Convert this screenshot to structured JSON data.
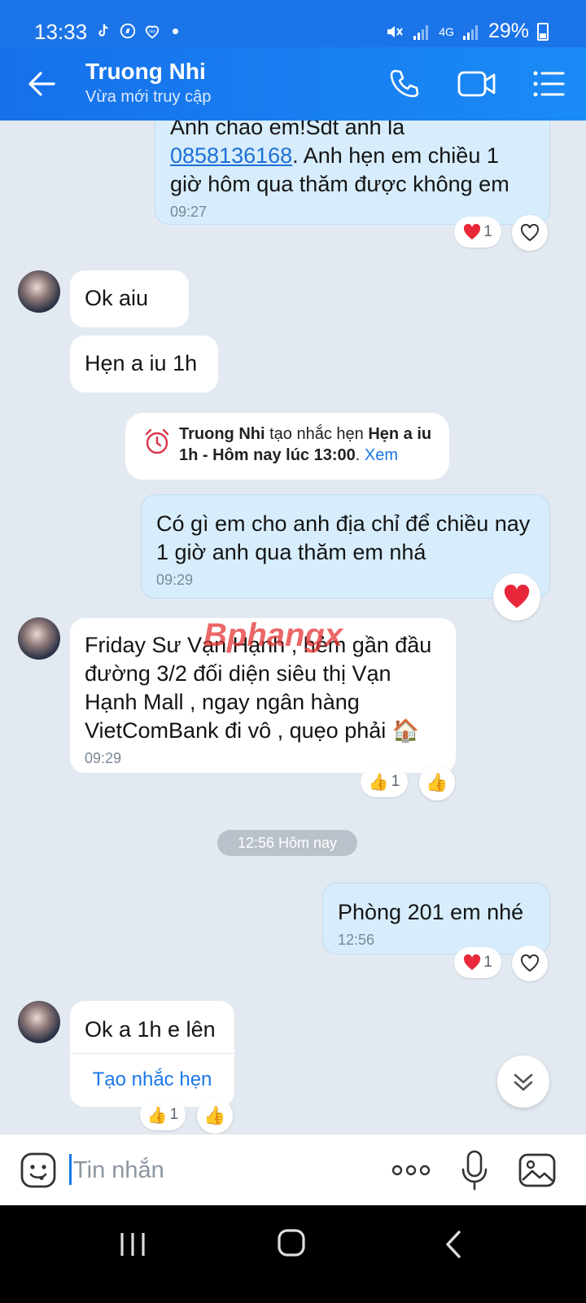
{
  "status_bar": {
    "time": "13:33",
    "battery": "29%",
    "network": "4G"
  },
  "header": {
    "title": "Truong Nhi",
    "subtitle": "Vừa mới truy cập"
  },
  "messages": [
    {
      "from": "me",
      "text_before": "Anh chao em!Sdt anh la",
      "phone": "0858136168",
      "text_after": ". Anh hẹn em chiều 1 giờ hôm qua thăm được không em",
      "time": "09:27",
      "reaction_count": "1"
    },
    {
      "from": "them",
      "text": "Ok aiu"
    },
    {
      "from": "them",
      "text": "Hẹn a iu 1h"
    },
    {
      "from": "me",
      "text": "Có gì em cho anh địa chỉ để chiều nay 1 giờ anh qua thăm em nhá",
      "time": "09:29"
    },
    {
      "from": "them",
      "text": "Friday Sư Vạn Hạnh , hẻm gần đầu đường 3/2 đối diện siêu thị Vạn Hạnh Mall , ngay ngân hàng VietComBank đi vô , quẹo phải 🏠",
      "time": "09:29",
      "reaction_count": "1"
    },
    {
      "from": "me",
      "text": "Phòng 201 em nhé",
      "time": "12:56",
      "reaction_count": "1"
    },
    {
      "from": "them",
      "text": "Ok a 1h e lên",
      "action": "Tạo nhắc hẹn",
      "reaction_count": "1"
    }
  ],
  "reminder": {
    "actor": "Truong Nhi",
    "verb": " tạo nhắc hẹn ",
    "title": "Hẹn a iu 1h - Hôm nay lúc 13:00",
    "view": "Xem"
  },
  "date_divider": "12:56 Hôm nay",
  "watermark": "Bphangx",
  "input": {
    "placeholder": "Tin nhắn"
  },
  "colors": {
    "header": "#1a7ef0",
    "mine_bubble": "#d7edfc",
    "theirs_bubble": "#ffffff",
    "background": "#e2e9f1",
    "heart": "#e8283a"
  }
}
